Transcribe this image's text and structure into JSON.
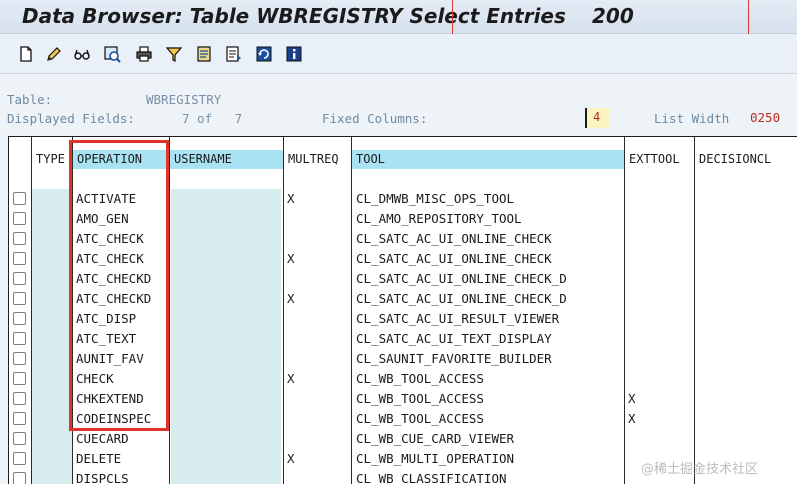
{
  "window": {
    "title": "Data Browser: Table WBREGISTRY Select Entries",
    "count": "200"
  },
  "toolbar": {
    "buttons": [
      {
        "name": "new-document-icon"
      },
      {
        "name": "edit-pencil-icon"
      },
      {
        "name": "glasses-display-icon"
      },
      {
        "name": "check-table-icon"
      },
      {
        "name": "print-icon"
      },
      {
        "name": "filter-icon"
      },
      {
        "name": "detail-list-icon"
      },
      {
        "name": "local-file-icon"
      },
      {
        "name": "refresh-icon"
      },
      {
        "name": "info-icon"
      }
    ]
  },
  "info": {
    "table_label": "Table:",
    "table_value": "WBREGISTRY",
    "displayed_label": "Displayed Fields:",
    "displayed_value": "7 of   7",
    "fixed_label": "Fixed Columns:",
    "fixed_value": "4",
    "listwidth_label": "List Width",
    "listwidth_value": "0250"
  },
  "table": {
    "columns": [
      "TYPE",
      "OPERATION",
      "USERNAME",
      "MULTREQ",
      "TOOL",
      "EXTTOOL",
      "DECISIONCL"
    ],
    "rows": [
      {
        "operation": "ACTIVATE",
        "multreq": "X",
        "tool": "CL_DMWB_MISC_OPS_TOOL",
        "exttool": ""
      },
      {
        "operation": "AMO_GEN",
        "multreq": "",
        "tool": "CL_AMO_REPOSITORY_TOOL",
        "exttool": ""
      },
      {
        "operation": "ATC_CHECK",
        "multreq": "",
        "tool": "CL_SATC_AC_UI_ONLINE_CHECK",
        "exttool": ""
      },
      {
        "operation": "ATC_CHECK",
        "multreq": "X",
        "tool": "CL_SATC_AC_UI_ONLINE_CHECK",
        "exttool": ""
      },
      {
        "operation": "ATC_CHECKD",
        "multreq": "",
        "tool": "CL_SATC_AC_UI_ONLINE_CHECK_D",
        "exttool": ""
      },
      {
        "operation": "ATC_CHECKD",
        "multreq": "X",
        "tool": "CL_SATC_AC_UI_ONLINE_CHECK_D",
        "exttool": ""
      },
      {
        "operation": "ATC_DISP",
        "multreq": "",
        "tool": "CL_SATC_AC_UI_RESULT_VIEWER",
        "exttool": ""
      },
      {
        "operation": "ATC_TEXT",
        "multreq": "",
        "tool": "CL_SATC_AC_UI_TEXT_DISPLAY",
        "exttool": ""
      },
      {
        "operation": "AUNIT_FAV",
        "multreq": "",
        "tool": "CL_SAUNIT_FAVORITE_BUILDER",
        "exttool": ""
      },
      {
        "operation": "CHECK",
        "multreq": "X",
        "tool": "CL_WB_TOOL_ACCESS",
        "exttool": ""
      },
      {
        "operation": "CHKEXTEND",
        "multreq": "",
        "tool": "CL_WB_TOOL_ACCESS",
        "exttool": "X"
      },
      {
        "operation": "CODEINSPEC",
        "multreq": "",
        "tool": "CL_WB_TOOL_ACCESS",
        "exttool": "X"
      },
      {
        "operation": "CUECARD",
        "multreq": "",
        "tool": "CL_WB_CUE_CARD_VIEWER",
        "exttool": ""
      },
      {
        "operation": "DELETE",
        "multreq": "X",
        "tool": "CL_WB_MULTI_OPERATION",
        "exttool": ""
      },
      {
        "operation": "DISPCLS",
        "multreq": "",
        "tool": "CL_WB_CLASSIFICATION",
        "exttool": ""
      }
    ]
  },
  "watermark": "@稀土掘金技术社区",
  "colors": {
    "header_cell": "#a9e2f3",
    "key_column": "#d7ecec",
    "highlight_box": "#e0332a",
    "fixed_value": "#c02a1d"
  }
}
